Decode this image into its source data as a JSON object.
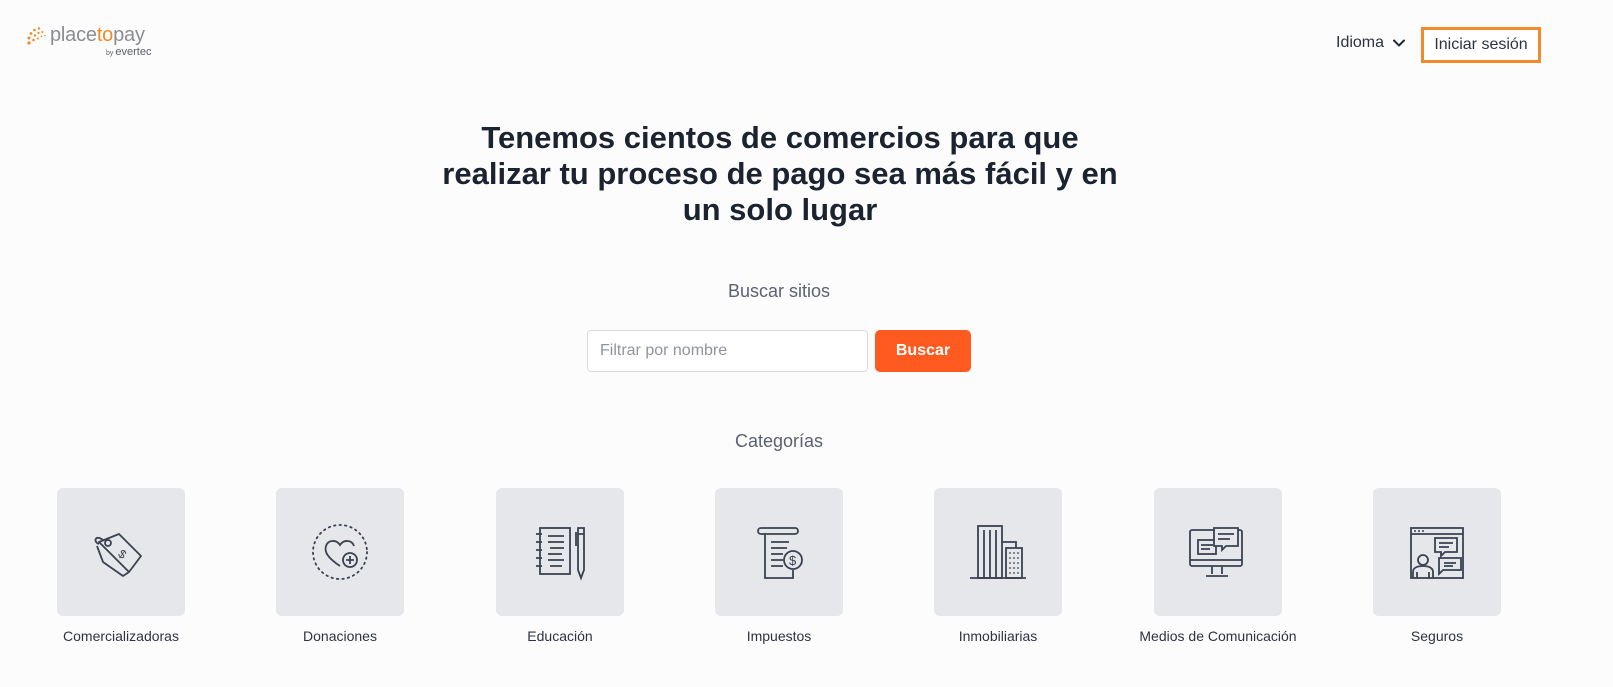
{
  "header": {
    "logo_prefix": "place",
    "logo_accent": "to",
    "logo_suffix": "pay",
    "logo_by": "by",
    "logo_sub": "evertec",
    "language_label": "Idioma",
    "login_label": "Iniciar sesión"
  },
  "hero": {
    "title": "Tenemos cientos de comercios para que realizar tu proceso de pago sea más fácil y en un solo lugar"
  },
  "search": {
    "label": "Buscar sitios",
    "placeholder": "Filtrar por nombre",
    "value": "",
    "button_label": "Buscar"
  },
  "categories": {
    "heading": "Categorías",
    "items": [
      {
        "label": "Comercializadoras",
        "icon": "price-tag-icon"
      },
      {
        "label": "Donaciones",
        "icon": "heart-donation-icon"
      },
      {
        "label": "Educación",
        "icon": "notebook-pen-icon"
      },
      {
        "label": "Impuestos",
        "icon": "tax-document-icon"
      },
      {
        "label": "Inmobiliarias",
        "icon": "buildings-icon"
      },
      {
        "label": "Medios de Comunicación",
        "icon": "monitor-chat-icon"
      },
      {
        "label": "Seguros",
        "icon": "agent-chat-icon"
      }
    ]
  },
  "colors": {
    "accent": "#ff5a1f",
    "login_border": "#f28a2c",
    "tile_bg": "#e6e7ea",
    "text_dark": "#1b2230"
  }
}
